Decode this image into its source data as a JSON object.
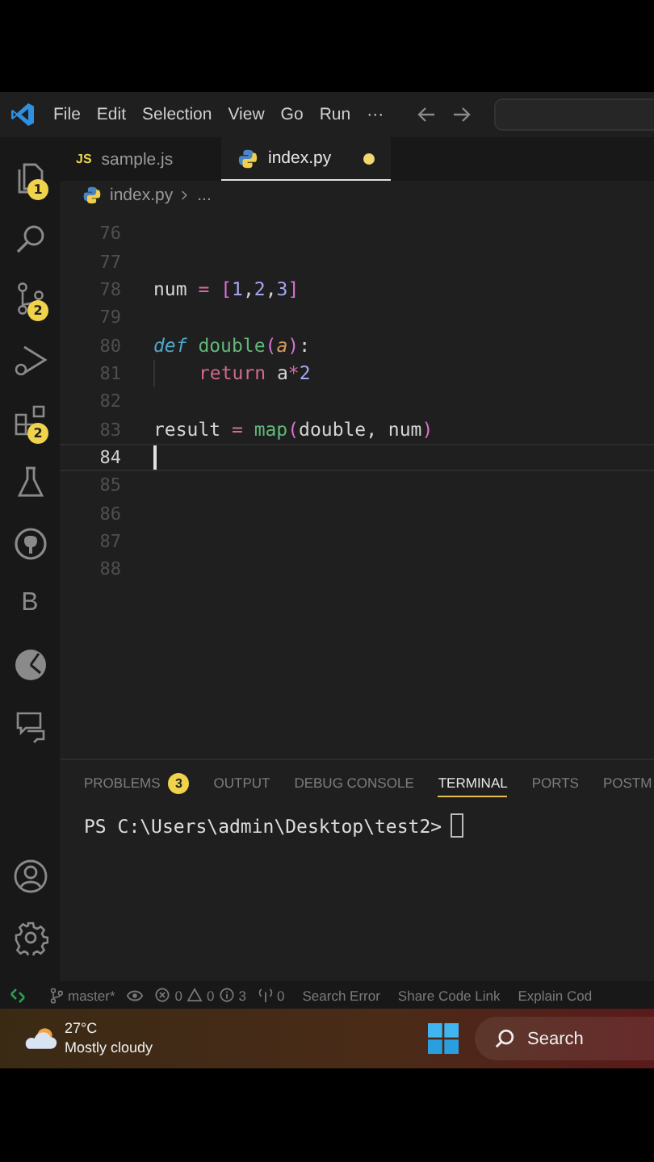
{
  "menu": [
    "File",
    "Edit",
    "Selection",
    "View",
    "Go",
    "Run",
    "···"
  ],
  "tabs": [
    {
      "kind": "js",
      "badge": "JS",
      "label": "sample.js",
      "selected": false,
      "modified": false
    },
    {
      "kind": "py",
      "label": "index.py",
      "selected": true,
      "modified": true
    }
  ],
  "breadcrumb": [
    "index.py",
    "..."
  ],
  "activity_bar": {
    "top": [
      {
        "kind": "explorer",
        "badge": "1"
      },
      {
        "kind": "search"
      },
      {
        "kind": "source-control",
        "badge": "2"
      },
      {
        "kind": "run"
      },
      {
        "kind": "extensions",
        "badge": "2"
      },
      {
        "kind": "testing"
      },
      {
        "kind": "github"
      },
      {
        "kind": "letter",
        "text": "B"
      },
      {
        "kind": "pie"
      },
      {
        "kind": "remote"
      }
    ],
    "bottom": [
      {
        "kind": "account"
      },
      {
        "kind": "settings"
      }
    ]
  },
  "editor": {
    "lines": [
      {
        "number": "76",
        "current": false,
        "indent": false
      },
      {
        "number": "77",
        "current": false,
        "indent": false
      },
      {
        "number": "78",
        "current": false,
        "indent": false,
        "tokens": [
          {
            "kind": "plain",
            "text": "num"
          },
          {
            "kind": "op",
            "text": " = "
          },
          {
            "kind": "bracket",
            "text": "["
          },
          {
            "kind": "number",
            "text": "1"
          },
          {
            "kind": "plain",
            "text": ","
          },
          {
            "kind": "number",
            "text": "2"
          },
          {
            "kind": "plain",
            "text": ","
          },
          {
            "kind": "number",
            "text": "3"
          },
          {
            "kind": "bracket",
            "text": "]"
          }
        ]
      },
      {
        "number": "79",
        "current": false,
        "indent": false
      },
      {
        "number": "80",
        "current": false,
        "indent": false,
        "tokens": [
          {
            "kind": "keyword",
            "text": "def "
          },
          {
            "kind": "function",
            "text": "double"
          },
          {
            "kind": "bracket",
            "text": "("
          },
          {
            "kind": "param",
            "text": "a"
          },
          {
            "kind": "bracket",
            "text": ")"
          },
          {
            "kind": "plain",
            "text": ":"
          }
        ]
      },
      {
        "number": "81",
        "current": false,
        "indent": true,
        "tokens": [
          {
            "kind": "control",
            "text": "return"
          },
          {
            "kind": "plain",
            "text": " a"
          },
          {
            "kind": "op",
            "text": "*"
          },
          {
            "kind": "number",
            "text": "2"
          }
        ]
      },
      {
        "number": "82",
        "current": false,
        "indent": false
      },
      {
        "number": "83",
        "current": false,
        "indent": false,
        "tokens": [
          {
            "kind": "plain",
            "text": "result"
          },
          {
            "kind": "op",
            "text": " = "
          },
          {
            "kind": "function",
            "text": "map"
          },
          {
            "kind": "bracket",
            "text": "("
          },
          {
            "kind": "plain",
            "text": "double, num"
          },
          {
            "kind": "bracket",
            "text": ")"
          }
        ]
      },
      {
        "number": "84",
        "current": true,
        "indent": false
      },
      {
        "number": "85",
        "current": false,
        "indent": false
      },
      {
        "number": "86",
        "current": false,
        "indent": false
      },
      {
        "number": "87",
        "current": false,
        "indent": false
      },
      {
        "number": "88",
        "current": false,
        "indent": false
      }
    ]
  },
  "panel": {
    "tabs": [
      {
        "label": "PROBLEMS",
        "badge": "3",
        "selected": false
      },
      {
        "label": "OUTPUT",
        "selected": false
      },
      {
        "label": "DEBUG CONSOLE",
        "selected": false
      },
      {
        "label": "TERMINAL",
        "selected": true
      },
      {
        "label": "PORTS",
        "selected": false
      },
      {
        "label": "POSTM",
        "selected": false
      }
    ],
    "terminal": {
      "prompt": "PS C:\\Users\\admin\\Desktop\\test2>"
    }
  },
  "status_bar": [
    {
      "kind": "remote"
    },
    {
      "kind": "branch",
      "text": "master*"
    },
    {
      "kind": "eye"
    },
    {
      "kind": "problems",
      "errors": "0",
      "warnings": "0",
      "info": "3"
    },
    {
      "kind": "ports",
      "text": "0"
    },
    {
      "kind": "text",
      "text": "Search Error"
    },
    {
      "kind": "text",
      "text": "Share Code Link"
    },
    {
      "kind": "text",
      "text": "Explain Cod"
    }
  ],
  "taskbar": {
    "temperature": "27°C",
    "condition": "Mostly cloudy",
    "search": "Search"
  }
}
